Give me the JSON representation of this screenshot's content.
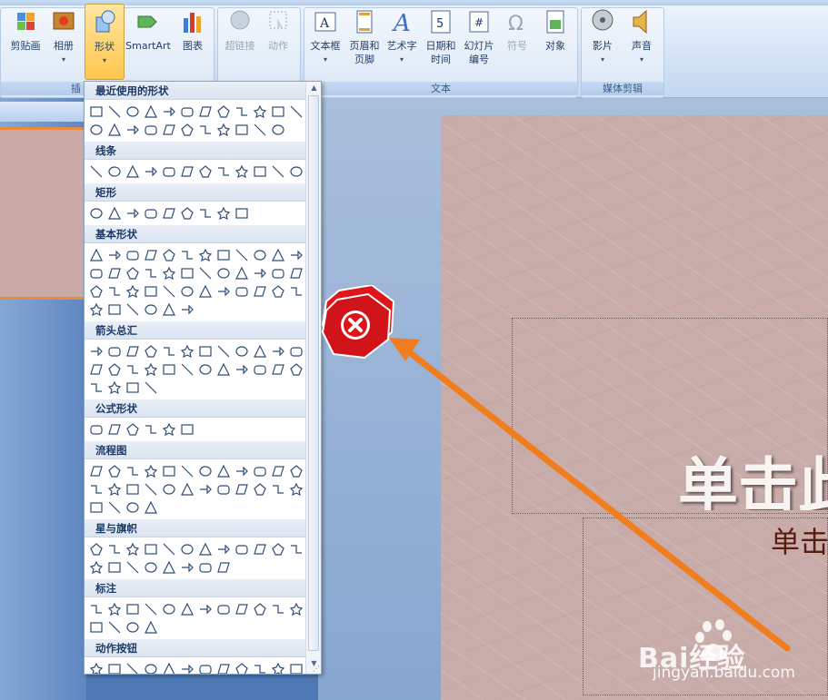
{
  "ribbon": {
    "buttons": [
      {
        "label": "剪贴画",
        "icon": "clipart-icon"
      },
      {
        "label": "相册",
        "icon": "album-icon",
        "dropdown": true
      },
      {
        "label": "形状",
        "icon": "shapes-icon",
        "dropdown": true,
        "active": true
      },
      {
        "label": "SmartArt",
        "icon": "smartart-icon"
      },
      {
        "label": "图表",
        "icon": "chart-icon"
      },
      {
        "label": "超链接",
        "icon": "hyperlink-icon",
        "disabled": true
      },
      {
        "label": "动作",
        "icon": "action-icon",
        "disabled": true
      },
      {
        "label": "文本框",
        "icon": "textbox-icon",
        "dropdown": true
      },
      {
        "label": "页眉和页脚",
        "icon": "header-footer-icon"
      },
      {
        "label": "艺术字",
        "icon": "wordart-icon",
        "dropdown": true
      },
      {
        "label": "日期和时间",
        "icon": "datetime-icon"
      },
      {
        "label": "幻灯片编号",
        "icon": "slide-number-icon"
      },
      {
        "label": "符号",
        "icon": "symbol-icon",
        "disabled": true
      },
      {
        "label": "对象",
        "icon": "object-icon"
      },
      {
        "label": "影片",
        "icon": "movie-icon",
        "dropdown": true
      },
      {
        "label": "声音",
        "icon": "sound-icon",
        "dropdown": true
      }
    ],
    "groups": {
      "text": "文本",
      "media": "媒体剪辑",
      "illus_partial": "插"
    }
  },
  "shapes_panel": {
    "sections": [
      {
        "title": "最近使用的形状",
        "count": 23
      },
      {
        "title": "线条",
        "count": 12
      },
      {
        "title": "矩形",
        "count": 9
      },
      {
        "title": "基本形状",
        "count": 42
      },
      {
        "title": "箭头总汇",
        "count": 28
      },
      {
        "title": "公式形状",
        "count": 6
      },
      {
        "title": "流程图",
        "count": 28
      },
      {
        "title": "星与旗帜",
        "count": 20
      },
      {
        "title": "标注",
        "count": 16
      },
      {
        "title": "动作按钮",
        "count": 12
      }
    ]
  },
  "slide": {
    "title": "单击此",
    "subtitle": "单击"
  },
  "watermark": {
    "brand": "Bai经验",
    "url": "jingyan.baidu.com"
  },
  "colors": {
    "accent": "#f07d1e",
    "error": "#e0151a",
    "ribbon": "#dbe7f6"
  }
}
